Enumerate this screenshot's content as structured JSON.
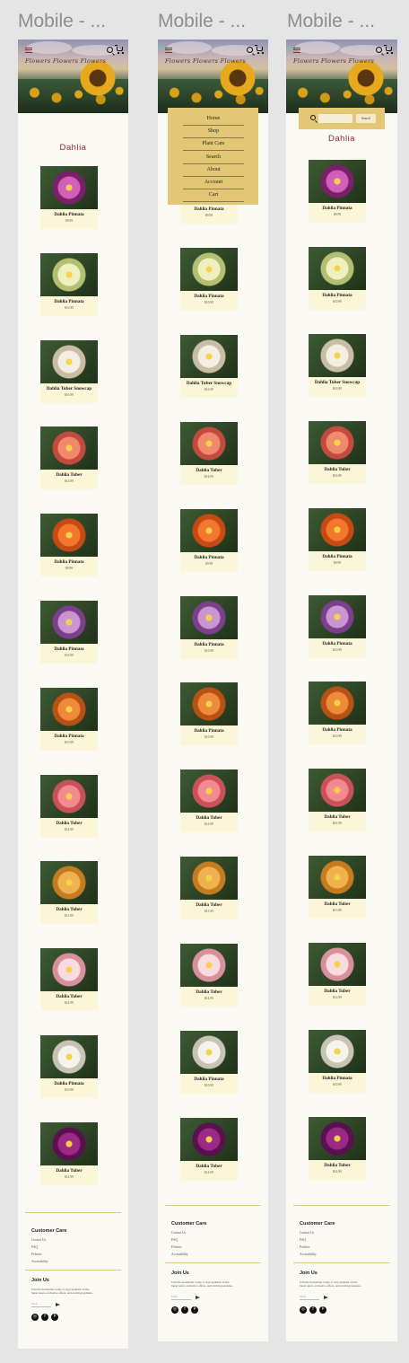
{
  "frames": [
    {
      "title": "Mobile - ..."
    },
    {
      "title": "Mobile - ..."
    },
    {
      "title": "Mobile - ..."
    }
  ],
  "header": {
    "tagline": "Flowers Flowers Flowers",
    "menu_icon": "hamburger-icon",
    "search_icon": "search-icon",
    "cart_icon": "cart-icon"
  },
  "page_title": "Dahlia",
  "products": [
    {
      "name": "Dahlia Pinnata",
      "price": "$9.99",
      "colors": [
        "#d25fb8",
        "#7a1f6a"
      ]
    },
    {
      "name": "Dahlia Pinnata",
      "price": "$10.99",
      "colors": [
        "#eef0c0",
        "#b3bf73"
      ]
    },
    {
      "name": "Dahlia Tuber Snowcap",
      "price": "$16.99",
      "colors": [
        "#f4efe4",
        "#c9bda3"
      ]
    },
    {
      "name": "Dahlia Tuber",
      "price": "$14.99",
      "colors": [
        "#f08a6d",
        "#c24a3f"
      ]
    },
    {
      "name": "Dahlia Pinnata",
      "price": "$9.99",
      "colors": [
        "#f3782d",
        "#c54a14"
      ]
    },
    {
      "name": "Dahlia Pinnata",
      "price": "$10.99",
      "colors": [
        "#c996d2",
        "#7c3f8c"
      ]
    },
    {
      "name": "Dahlia Pinnata",
      "price": "$10.99",
      "colors": [
        "#ee8a3a",
        "#b55214"
      ]
    },
    {
      "name": "Dahlia Tuber",
      "price": "$14.99",
      "colors": [
        "#f28a90",
        "#c9525a"
      ]
    },
    {
      "name": "Dahlia Tuber",
      "price": "$13.99",
      "colors": [
        "#f0b251",
        "#c57b1f"
      ]
    },
    {
      "name": "Dahlia Tuber",
      "price": "$14.99",
      "colors": [
        "#f7dbe0",
        "#d9909d"
      ]
    },
    {
      "name": "Dahlia Pinnata",
      "price": "$10.99",
      "colors": [
        "#f4f3ee",
        "#c7c4b4"
      ]
    },
    {
      "name": "Dahlia Tuber",
      "price": "$14.99",
      "colors": [
        "#9a2a86",
        "#5b1050"
      ]
    }
  ],
  "footer": {
    "customer_care": {
      "heading": "Customer Care",
      "links": [
        "Contact Us",
        "FAQ",
        "Policies",
        "Accessibility"
      ]
    },
    "join_us": {
      "heading": "Join Us",
      "text": "Join the newsletter today to stay updated on the latest news, exclusive offers, and exciting updates.",
      "email_placeholder": "Email",
      "send_icon": "send-icon"
    },
    "social_icons": [
      "instagram-icon",
      "facebook-icon",
      "pinterest-icon"
    ]
  },
  "menu": {
    "items": [
      "Home",
      "Shop",
      "Plant Care",
      "Search",
      "About",
      "Account",
      "Cart"
    ]
  },
  "search_overlay": {
    "icon": "search-icon",
    "placeholder": "",
    "button_label": "Search"
  },
  "colors": {
    "page_bg": "#faf9f3",
    "card_bg": "#fbf6d8",
    "overlay": "#e3c775",
    "title": "#8a2a35",
    "divider": "#e4c77a"
  }
}
